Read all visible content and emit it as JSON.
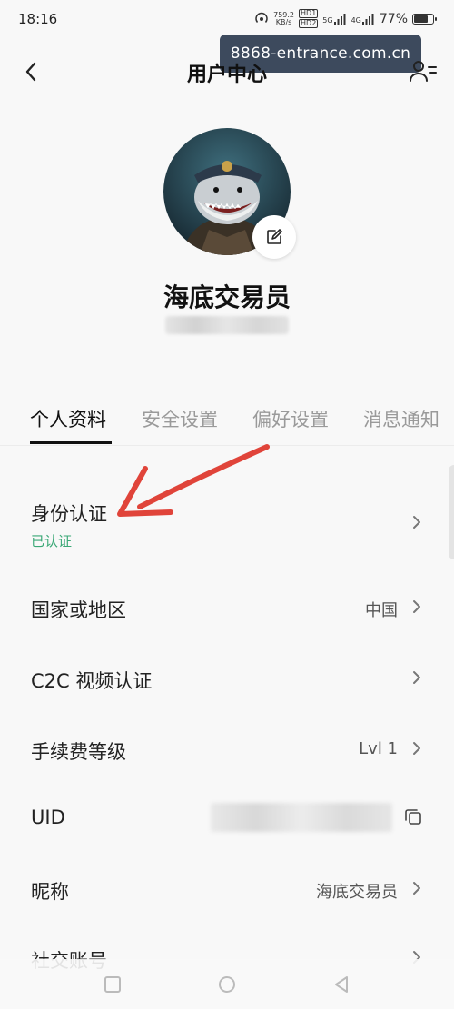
{
  "status_bar": {
    "time": "18:16",
    "net_speed_value": "759.2",
    "net_speed_unit": "KB/s",
    "hd_tag_1": "HD1",
    "hd_tag_2": "HD2",
    "network_5g": "5G",
    "network_4g": "4G",
    "battery_text": "77%",
    "battery_level": 0.77
  },
  "watermark": {
    "text": "8868-entrance.com.cn"
  },
  "header": {
    "title": "用户中心"
  },
  "profile": {
    "nickname": "海底交易员"
  },
  "tabs": [
    {
      "label": "个人资料",
      "active": true
    },
    {
      "label": "安全设置",
      "active": false
    },
    {
      "label": "偏好设置",
      "active": false
    },
    {
      "label": "消息通知",
      "active": false
    }
  ],
  "rows": {
    "identity": {
      "label": "身份认证",
      "status": "已认证"
    },
    "country": {
      "label": "国家或地区",
      "value": "中国"
    },
    "c2c_video": {
      "label": "C2C 视频认证"
    },
    "fee_level": {
      "label": "手续费等级",
      "value": "Lvl 1"
    },
    "uid": {
      "label": "UID"
    },
    "nickname": {
      "label": "昵称",
      "value": "海底交易员"
    },
    "social": {
      "label": "社交账号"
    }
  },
  "colors": {
    "verified_green": "#3aa876",
    "annotation_arrow": "#e0443a",
    "watermark_bg": "#3d4a5d"
  }
}
